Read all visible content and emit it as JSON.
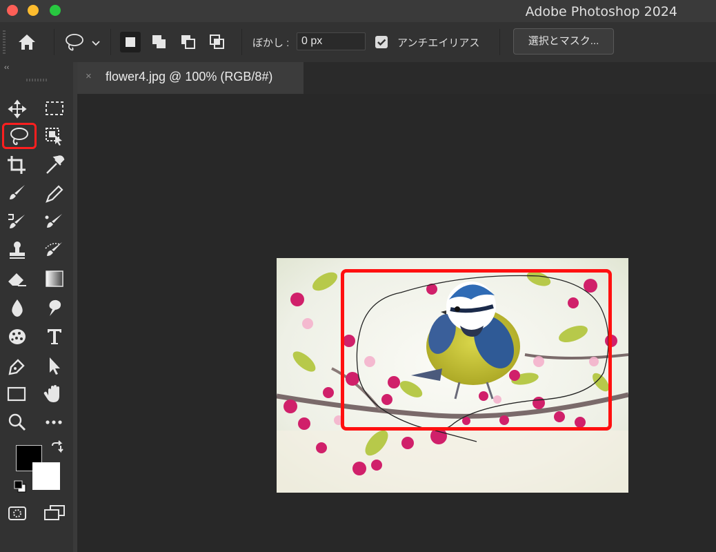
{
  "window": {
    "app_title": "Adobe Photoshop 2024"
  },
  "options_bar": {
    "blur_label": "ぼかし :",
    "blur_value": "0 px",
    "antialias_label": "アンチエイリアス",
    "antialias_checked": true,
    "select_mask_button": "選択とマスク..."
  },
  "toolbar": {
    "collapse_label": "‹‹",
    "active_tool": "lasso-tool",
    "foreground_color": "#000000",
    "background_color": "#ffffff"
  },
  "document": {
    "tab_title": "flower4.jpg @ 100% (RGB/8#)",
    "tab_close": "×"
  },
  "colors": {
    "highlight": "#ff1010",
    "ui_dark": "#323232",
    "canvas": "#282828"
  }
}
